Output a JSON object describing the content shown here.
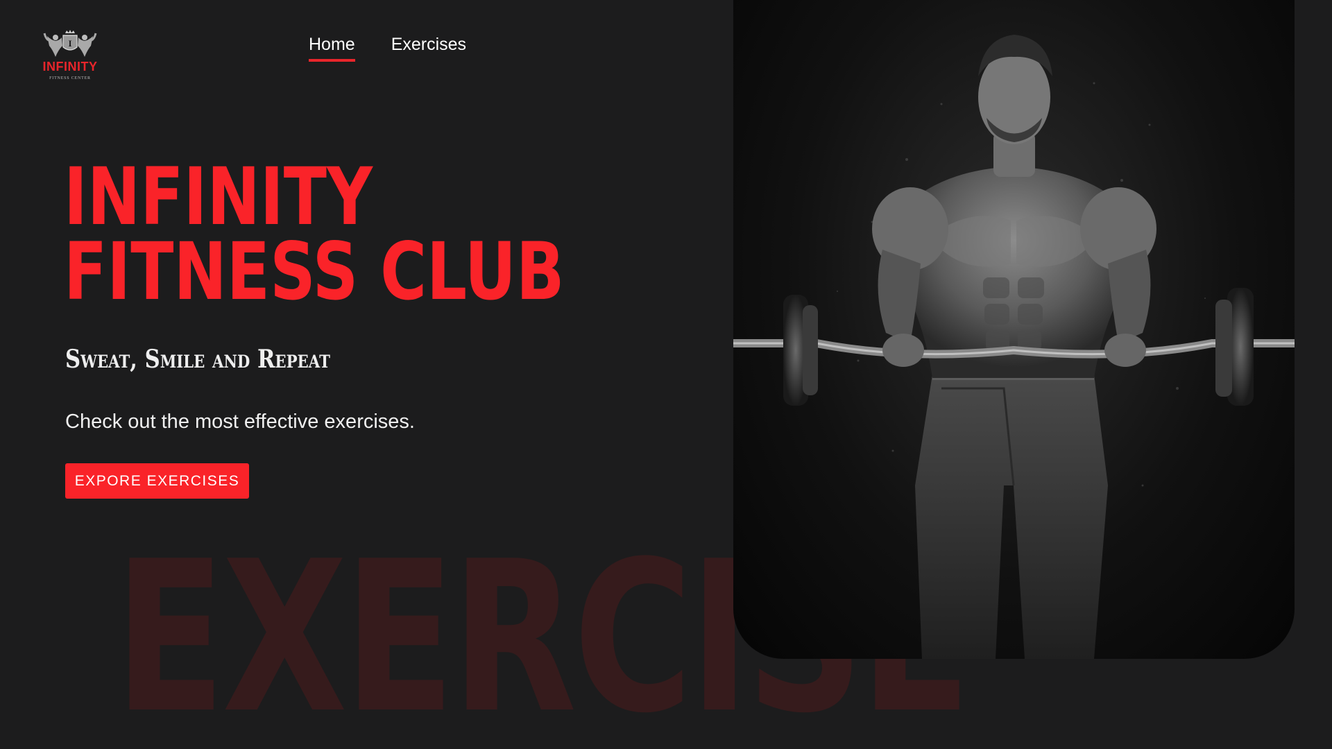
{
  "logo": {
    "brand": "INFINITY",
    "subtitle": "FITNESS CENTER",
    "emblem_letter": "I"
  },
  "nav": {
    "items": [
      {
        "label": "Home",
        "active": true
      },
      {
        "label": "Exercises",
        "active": false
      }
    ]
  },
  "hero": {
    "title_line1": "INFINITY",
    "title_line2": "FITNESS CLUB",
    "subtitle": "Sweat, Smile and Repeat",
    "description": "Check out the most effective exercises.",
    "cta_label": "EXPORE EXERCISES",
    "watermark": "EXERCISE",
    "image_alt": "Muscular man lifting barbell"
  },
  "colors": {
    "accent": "#fa2329",
    "background": "#1c1c1d",
    "watermark": "#361b1c",
    "text": "#ffffff"
  }
}
